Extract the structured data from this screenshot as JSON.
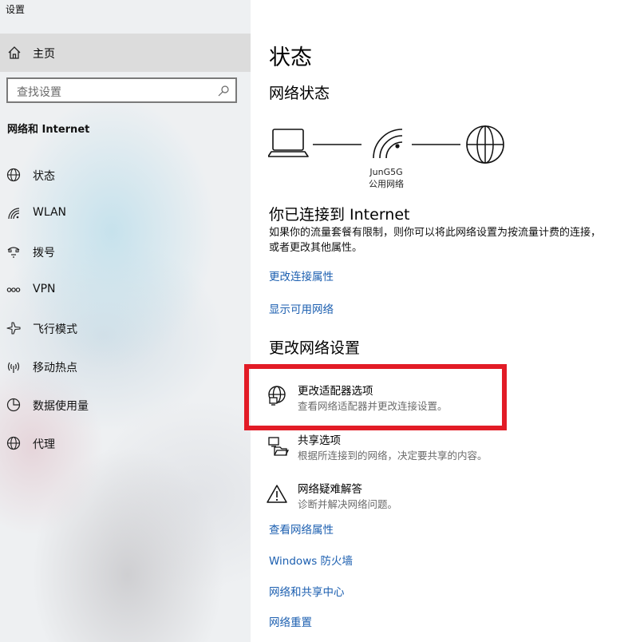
{
  "app": {
    "title": "设置"
  },
  "sidebar": {
    "home_label": "主页",
    "search": {
      "placeholder": "查找设置"
    },
    "section_title": "网络和 Internet",
    "items": [
      {
        "label": "状态",
        "icon": "globe-icon"
      },
      {
        "label": "WLAN",
        "icon": "wifi-icon"
      },
      {
        "label": "拨号",
        "icon": "dialup-icon"
      },
      {
        "label": "VPN",
        "icon": "vpn-icon"
      },
      {
        "label": "飞行模式",
        "icon": "airplane-icon"
      },
      {
        "label": "移动热点",
        "icon": "hotspot-icon"
      },
      {
        "label": "数据使用量",
        "icon": "data-usage-icon"
      },
      {
        "label": "代理",
        "icon": "globe-icon"
      }
    ]
  },
  "main": {
    "title": "状态",
    "network_status_heading": "网络状态",
    "network": {
      "ssid": "JunG5G",
      "type": "公用网络"
    },
    "connected_heading": "你已连接到 Internet",
    "connected_desc": "如果你的流量套餐有限制，则你可以将此网络设置为按流量计费的连接，或者更改其他属性。",
    "links_top": [
      "更改连接属性",
      "显示可用网络"
    ],
    "change_heading": "更改网络设置",
    "options": [
      {
        "title": "更改适配器选项",
        "subtitle": "查看网络适配器并更改连接设置。",
        "icon": "adapter-icon"
      },
      {
        "title": "共享选项",
        "subtitle": "根据所连接到的网络，决定要共享的内容。",
        "icon": "sharing-icon"
      },
      {
        "title": "网络疑难解答",
        "subtitle": "诊断并解决网络问题。",
        "icon": "warning-icon"
      }
    ],
    "links_bottom": [
      "查看网络属性",
      "Windows 防火墙",
      "网络和共享中心",
      "网络重置"
    ]
  },
  "colors": {
    "link": "#1c5fb0",
    "highlight": "#e21b26",
    "sidebar_selected": "#dcdcdc"
  }
}
